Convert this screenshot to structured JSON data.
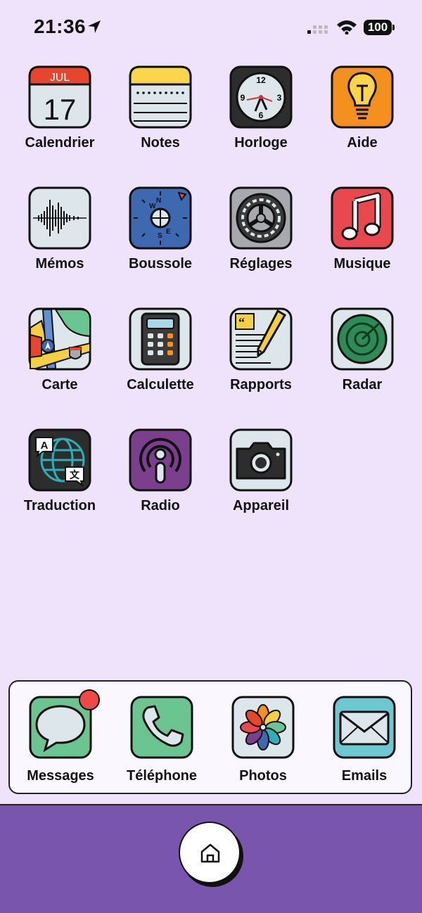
{
  "status": {
    "time": "21:36",
    "battery": "100"
  },
  "apps": [
    {
      "label": "Calendrier",
      "icon": "calendar-icon",
      "month": "JUL",
      "day": "17"
    },
    {
      "label": "Notes",
      "icon": "notes-icon"
    },
    {
      "label": "Horloge",
      "icon": "clock-icon",
      "n12": "12",
      "n3": "3",
      "n6": "6",
      "n9": "9"
    },
    {
      "label": "Aide",
      "icon": "lightbulb-icon"
    },
    {
      "label": "Mémos",
      "icon": "waveform-icon"
    },
    {
      "label": "Boussole",
      "icon": "compass-icon",
      "n": "N",
      "e": "E",
      "s": "S",
      "w": "W"
    },
    {
      "label": "Réglages",
      "icon": "gear-icon"
    },
    {
      "label": "Musique",
      "icon": "music-note-icon"
    },
    {
      "label": "Carte",
      "icon": "map-icon"
    },
    {
      "label": "Calculette",
      "icon": "calculator-icon"
    },
    {
      "label": "Rapports",
      "icon": "newspaper-icon"
    },
    {
      "label": "Radar",
      "icon": "radar-icon"
    },
    {
      "label": "Traduction",
      "icon": "translate-icon",
      "a": "A"
    },
    {
      "label": "Radio",
      "icon": "podcast-icon"
    },
    {
      "label": "Appareil",
      "icon": "camera-icon"
    }
  ],
  "dock": [
    {
      "label": "Messages",
      "icon": "message-bubble-icon",
      "has_badge": true
    },
    {
      "label": "Téléphone",
      "icon": "phone-icon"
    },
    {
      "label": "Photos",
      "icon": "photos-flower-icon"
    },
    {
      "label": "Emails",
      "icon": "envelope-icon"
    }
  ],
  "home_icon": "home-icon",
  "colors": {
    "background": "#EEE3FB",
    "bottom_bar": "#7955AE",
    "badge": "#F04848"
  }
}
